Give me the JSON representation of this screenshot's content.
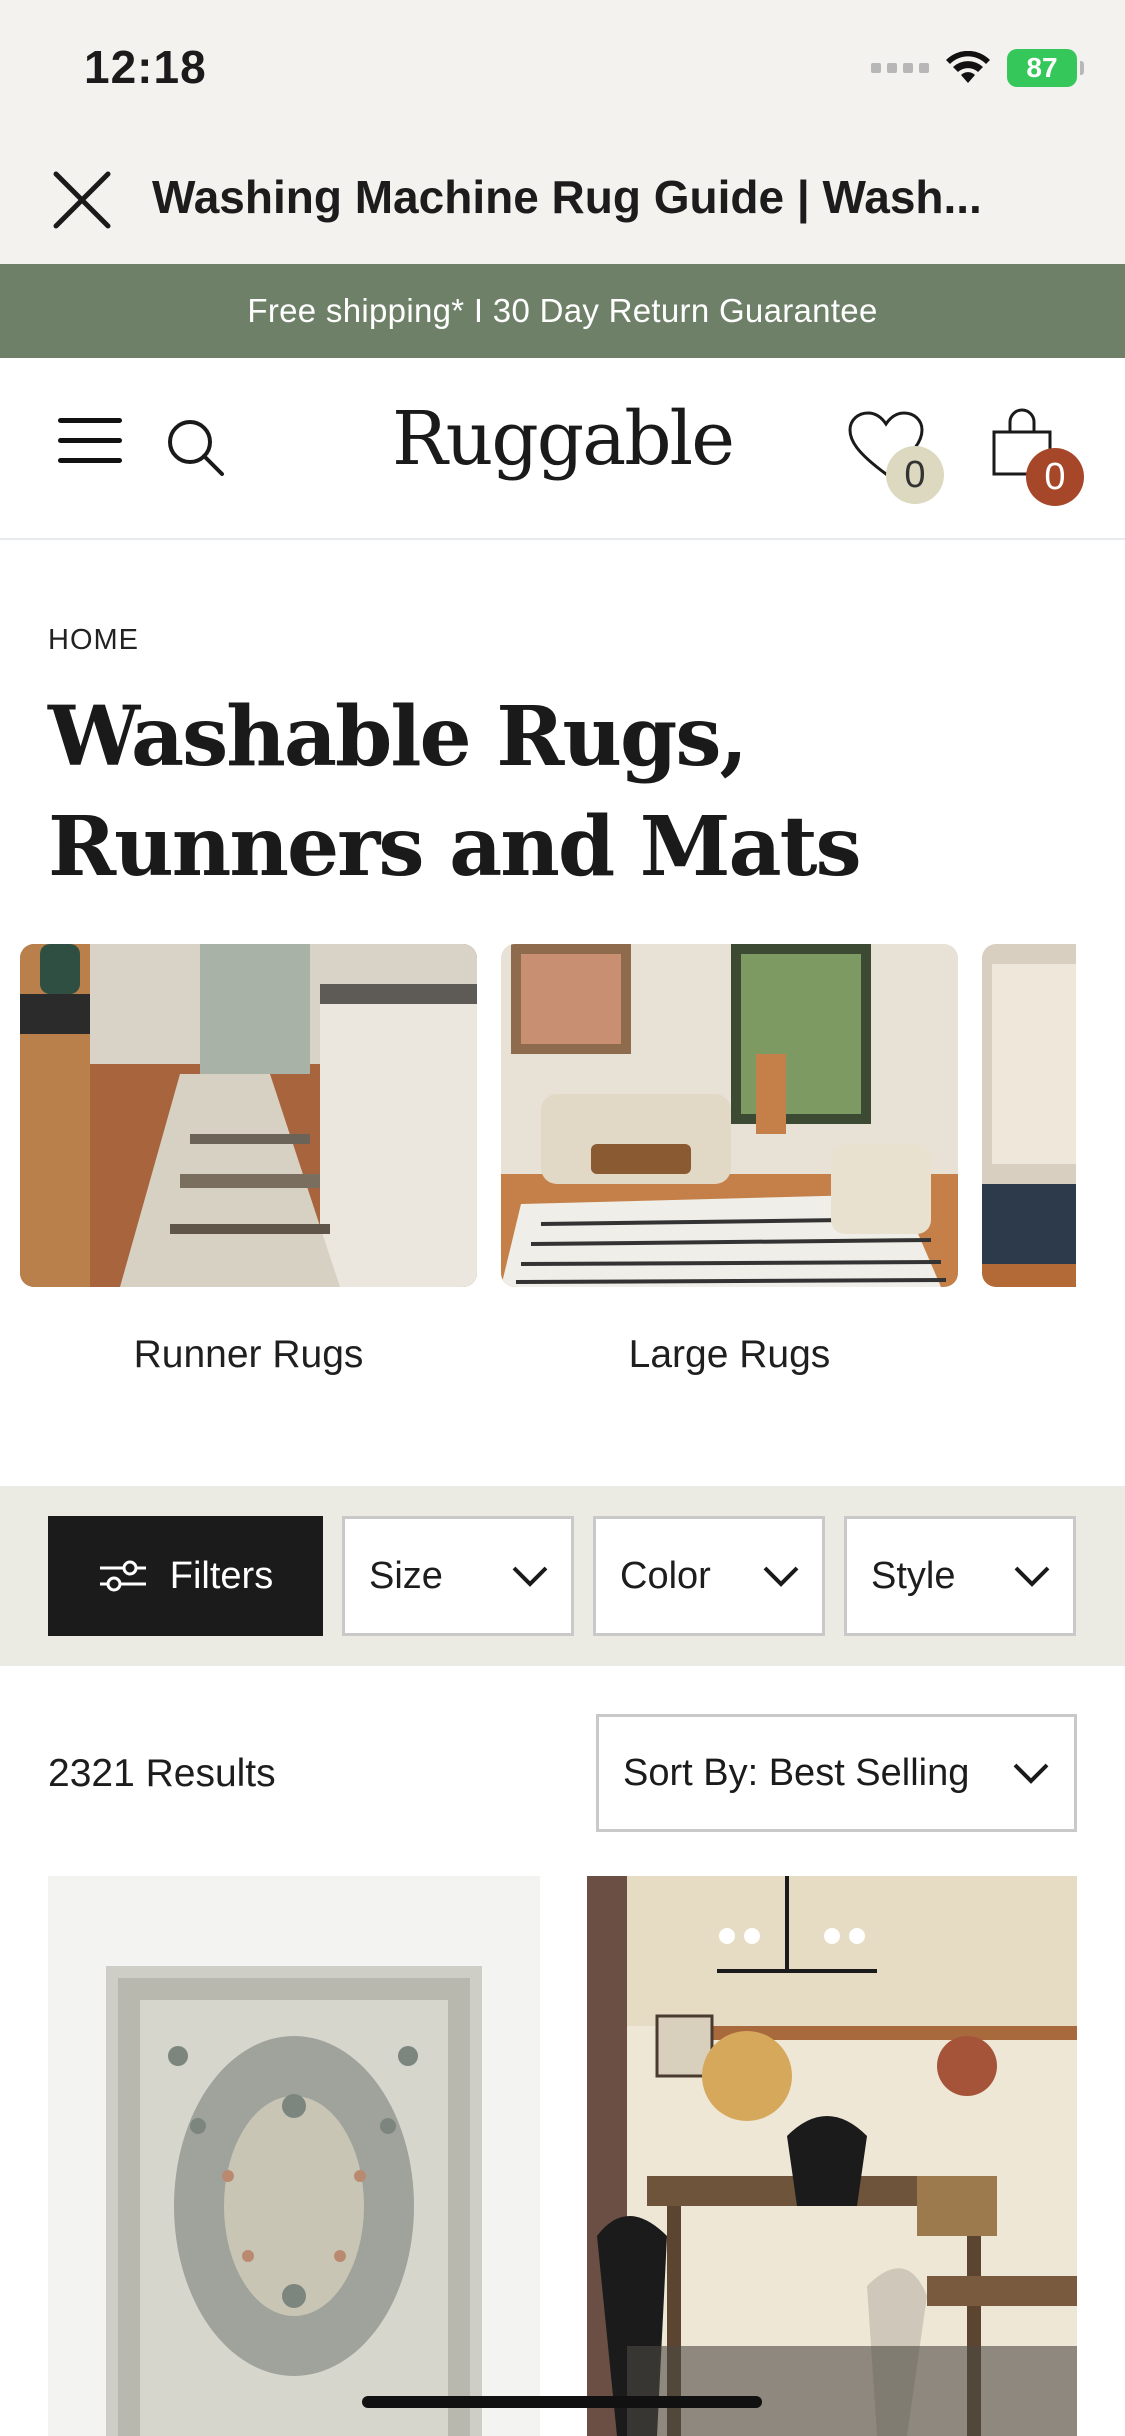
{
  "status_bar": {
    "time": "12:18",
    "battery": "87"
  },
  "browser_header": {
    "title": "Washing Machine Rug Guide | Wash..."
  },
  "promo_banner": {
    "text": "Free shipping* I 30 Day Return Guarantee",
    "background": "#6f8069"
  },
  "site_header": {
    "logo": "Ruggable",
    "wishlist_count": "0",
    "cart_count": "0",
    "icons": [
      "menu-icon",
      "search-icon",
      "heart-icon",
      "shopping-bag-icon"
    ]
  },
  "breadcrumb": {
    "home": "HOME"
  },
  "page_title": "Washable Rugs, Runners and Mats",
  "categories": [
    {
      "label": "Runner Rugs"
    },
    {
      "label": "Large Rugs"
    },
    {
      "label": ""
    }
  ],
  "filters": {
    "filters_label": "Filters",
    "size_label": "Size",
    "color_label": "Color",
    "style_label": "Style"
  },
  "results": {
    "count_text": "2321 Results",
    "sort_label": "Sort By: Best Selling"
  },
  "colors": {
    "accent_dark": "#1b1b1b",
    "cart_badge": "#a7472a",
    "filter_bar_bg": "#ecebe3"
  }
}
